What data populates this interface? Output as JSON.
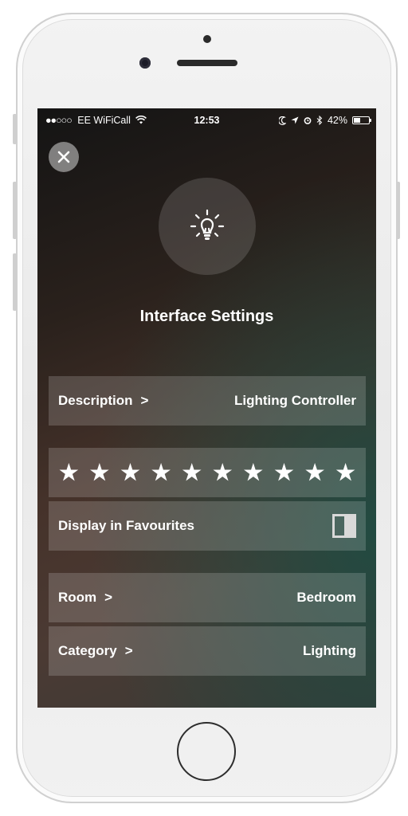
{
  "status_bar": {
    "signal_dots": "●●○○○",
    "carrier": "EE WiFiCall",
    "time": "12:53",
    "battery_percent": "42%",
    "battery_level": 0.42,
    "icons": [
      "wifi-icon",
      "moon-icon",
      "location-arrow-icon",
      "alarm-icon",
      "bluetooth-icon",
      "battery-icon"
    ]
  },
  "header": {
    "close_icon": "close-icon",
    "device_icon": "lightbulb-icon",
    "title": "Interface Settings"
  },
  "settings": {
    "description": {
      "label": "Description",
      "chevron": ">",
      "value": "Lighting Controller"
    },
    "rating": {
      "stars_total": 10,
      "stars_filled": 10,
      "star_glyph": "★"
    },
    "favourites": {
      "label": "Display in Favourites"
    },
    "room": {
      "label": "Room",
      "chevron": ">",
      "value": "Bedroom"
    },
    "category": {
      "label": "Category",
      "chevron": ">",
      "value": "Lighting"
    }
  },
  "colors": {
    "text": "#ffffff",
    "row_background": "rgba(255,255,255,0.17)",
    "accent_teal": "#145046"
  }
}
